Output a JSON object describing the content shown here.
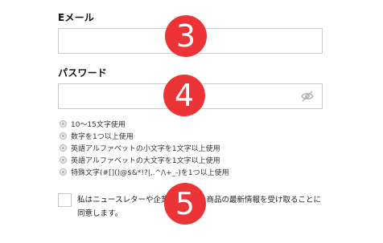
{
  "email": {
    "label": "Eメール",
    "value": "",
    "placeholder": ""
  },
  "password": {
    "label": "パスワード",
    "value": "",
    "placeholder": "",
    "toggle_icon": "eye-slash-icon"
  },
  "password_rules": [
    "10～15文字使用",
    "数字を1つ以上使用",
    "英語アルファベットの小文字を1文字以上使用",
    "英語アルファベットの大文字を1文字以上使用",
    "特殊文字(#[]()@$&*!?|,.^/\\+_-)を1つ以上使用"
  ],
  "newsletter": {
    "checked": false,
    "text": "私はニュースレターや企業ニュース、商品の最新情報を受け取ることに同意します。"
  },
  "step_badges": [
    "3",
    "4",
    "5"
  ],
  "colors": {
    "badge": "#ec3335",
    "border": "#c9c9c9"
  }
}
